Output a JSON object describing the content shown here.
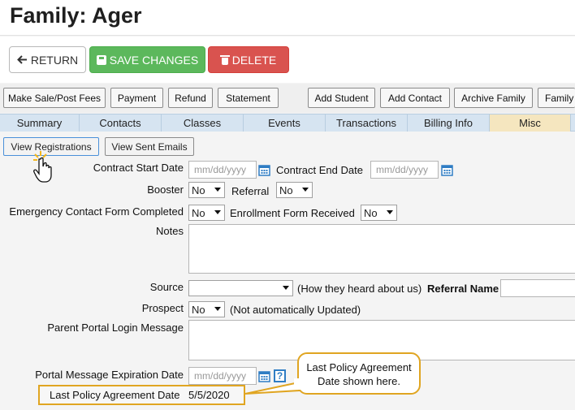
{
  "page": {
    "title": "Family: Ager"
  },
  "buttons": {
    "return": "RETURN",
    "save": "SAVE CHANGES",
    "delete": "DELETE"
  },
  "actions": [
    "Make Sale/Post Fees",
    "Payment",
    "Refund",
    "Statement",
    "Add Student",
    "Add Contact",
    "Archive Family",
    "Family"
  ],
  "tabs": [
    "Summary",
    "Contacts",
    "Classes",
    "Events",
    "Transactions",
    "Billing Info",
    "Misc"
  ],
  "active_tab": "Misc",
  "subactions": {
    "view_registrations": "View Registrations",
    "view_sent_emails": "View Sent Emails"
  },
  "form": {
    "contract_start_label": "Contract Start Date",
    "contract_start_placeholder": "mm/dd/yyyy",
    "contract_end_label": "Contract End Date",
    "contract_end_placeholder": "mm/dd/yyyy",
    "booster_label": "Booster",
    "booster_value": "No",
    "referral_label": "Referral",
    "referral_value": "No",
    "emergency_label": "Emergency Contact Form Completed",
    "emergency_value": "No",
    "enrollment_label": "Enrollment Form Received",
    "enrollment_value": "No",
    "notes_label": "Notes",
    "source_label": "Source",
    "source_value": "",
    "source_hint": "(How they heard about us)",
    "referral_name_label": "Referral Name",
    "prospect_label": "Prospect",
    "prospect_value": "No",
    "prospect_hint": "(Not automatically Updated)",
    "portal_message_label": "Parent Portal Login Message",
    "portal_expiration_label": "Portal Message Expiration Date",
    "portal_expiration_placeholder": "mm/dd/yyyy",
    "help_glyph": "?",
    "policy_label": "Last Policy Agreement Date",
    "policy_value": "5/5/2020"
  },
  "callout": {
    "line1": "Last Policy Agreement",
    "line2": "Date shown here."
  },
  "colors": {
    "save": "#5cb85c",
    "delete": "#d9534f",
    "tab_bar": "#d6e4f1",
    "active_tab": "#f5e6bf",
    "highlight": "#e0a521",
    "calendar_icon": "#2f7dc4"
  }
}
